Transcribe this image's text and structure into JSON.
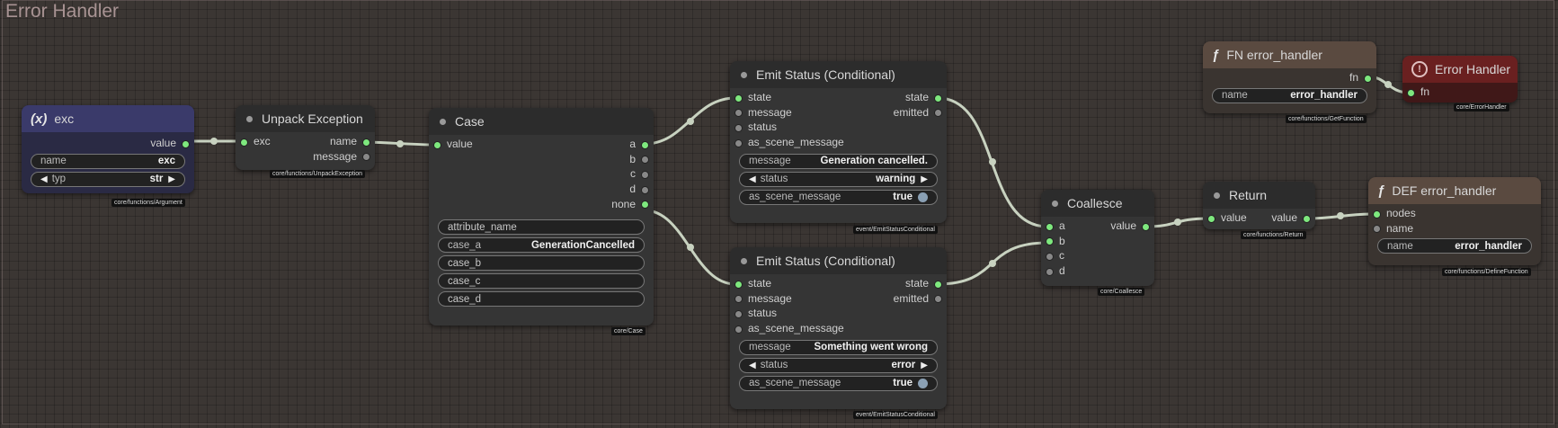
{
  "group": {
    "title": "Error Handler"
  },
  "nodes": {
    "exc": {
      "title": "exc",
      "icon_text": "(x)",
      "tag": "core/functions/Argument",
      "out_value": "value",
      "name_label": "name",
      "name_value": "exc",
      "typ_label": "typ",
      "typ_value": "str"
    },
    "unpack": {
      "title": "Unpack Exception",
      "tag": "core/functions/UnpackException",
      "in_exc": "exc",
      "out_name": "name",
      "out_message": "message"
    },
    "case": {
      "title": "Case",
      "tag": "core/Case",
      "in_value": "value",
      "outs": [
        "a",
        "b",
        "c",
        "d",
        "none"
      ],
      "attribute_name": "attribute_name",
      "case_a_label": "case_a",
      "case_a_value": "GenerationCancelled",
      "case_b": "case_b",
      "case_c": "case_c",
      "case_d": "case_d"
    },
    "emit1": {
      "title": "Emit Status (Conditional)",
      "tag": "event/EmitStatusConditional",
      "in_state": "state",
      "in_message": "message",
      "in_status": "status",
      "in_asm": "as_scene_message",
      "out_state": "state",
      "out_emitted": "emitted",
      "message_label": "message",
      "message_value": "Generation cancelled.",
      "status_label": "status",
      "status_value": "warning",
      "asm_label": "as_scene_message",
      "asm_value": "true"
    },
    "emit2": {
      "title": "Emit Status (Conditional)",
      "tag": "event/EmitStatusConditional",
      "in_state": "state",
      "in_message": "message",
      "in_status": "status",
      "in_asm": "as_scene_message",
      "out_state": "state",
      "out_emitted": "emitted",
      "message_label": "message",
      "message_value": "Something went wrong",
      "status_label": "status",
      "status_value": "error",
      "asm_label": "as_scene_message",
      "asm_value": "true"
    },
    "coalesce": {
      "title": "Coallesce",
      "tag": "core/Coallesce",
      "ins": [
        "a",
        "b",
        "c",
        "d"
      ],
      "out_value": "value"
    },
    "ret": {
      "title": "Return",
      "tag": "core/functions/Return",
      "in_value": "value",
      "out_value": "value"
    },
    "fn": {
      "title": "FN error_handler",
      "icon_text": "ƒ",
      "tag": "core/functions/GetFunction",
      "out_fn": "fn",
      "name_label": "name",
      "name_value": "error_handler"
    },
    "errh": {
      "title": "Error Handler",
      "icon_text": "!",
      "tag": "core/ErrorHandler",
      "in_fn": "fn"
    },
    "def": {
      "title": "DEF error_handler",
      "icon_text": "ƒ",
      "tag": "core/functions/DefineFunction",
      "in_nodes": "nodes",
      "in_name": "name",
      "name_label": "name",
      "name_value": "error_handler"
    }
  },
  "colors": {
    "canvas": "#3b3633",
    "node_body": "#353535",
    "node_header": "#2c2c2c",
    "arg_header": "#3a3a6a",
    "arg_body": "#2a2a44",
    "fn_header": "#5a4a40",
    "fn_body": "#3a3430",
    "err_header": "#6a2020",
    "err_body": "#401818",
    "socket_connected": "#7ee87e",
    "socket_idle": "#888888",
    "wire": "#c8d2c0"
  }
}
